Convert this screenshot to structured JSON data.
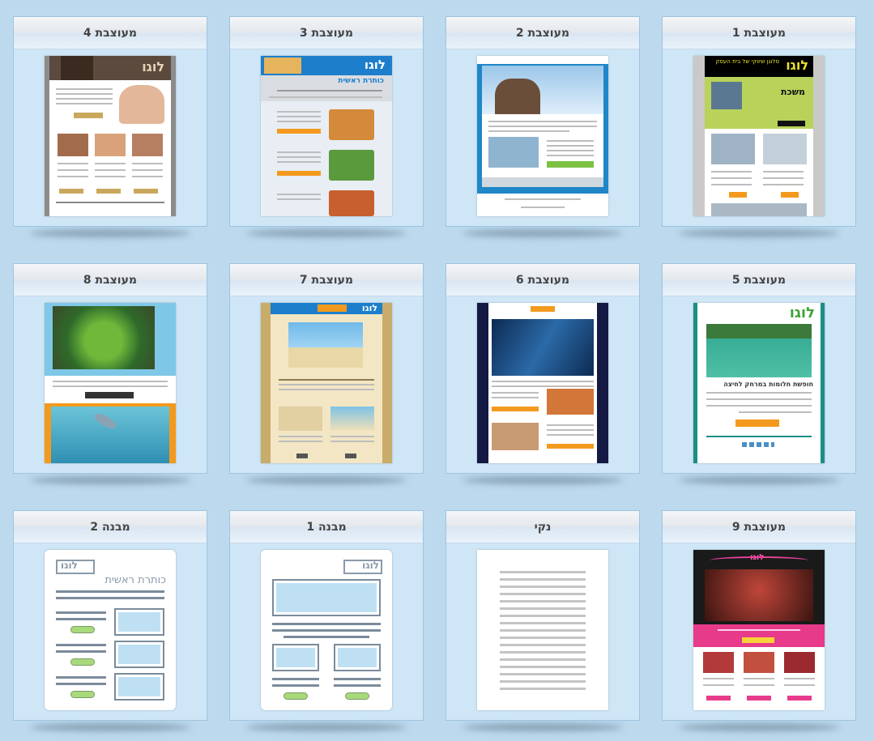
{
  "templates": [
    {
      "title": "מעוצבת 1"
    },
    {
      "title": "מעוצבת 2"
    },
    {
      "title": "מעוצבת 3"
    },
    {
      "title": "מעוצבת 4"
    },
    {
      "title": "מעוצבת 5"
    },
    {
      "title": "מעוצבת 6"
    },
    {
      "title": "מעוצבת 7"
    },
    {
      "title": "מעוצבת 8"
    },
    {
      "title": "מעוצבת 9"
    },
    {
      "title": "נקי"
    },
    {
      "title": "מבנה 1"
    },
    {
      "title": "מבנה 2"
    }
  ],
  "thumbs": {
    "t1": {
      "logo": "לוגו",
      "slogan": "סלוגן שיווקי של בית העסק",
      "headline": "משכת"
    },
    "t3": {
      "logo": "לוגו",
      "headline": "כותרת ראשית"
    },
    "t4": {
      "logo": "לוגו"
    },
    "t5": {
      "logo": "לוגו",
      "headline": "חופשת חלומות במרחק לחיצה"
    },
    "t7": {
      "logo": "לוגו"
    },
    "t9": {
      "logo": "לוגו"
    },
    "s1": {
      "logo": "לוגו"
    },
    "s2": {
      "logo": "לוגו",
      "headline": "כותרת ראשית"
    }
  },
  "colors": {
    "page_bg": "#bcd9ee",
    "card_bg": "#cfe6f7",
    "accent_orange": "#f39a1e",
    "accent_green": "#7cc144"
  }
}
